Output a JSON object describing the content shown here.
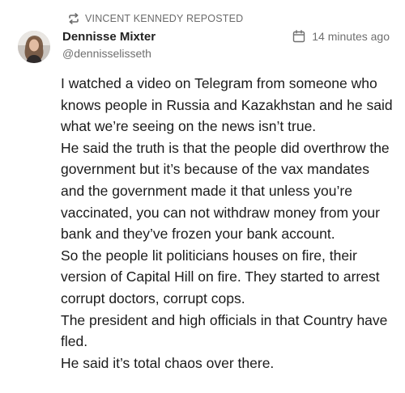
{
  "repost": {
    "label": "VINCENT KENNEDY REPOSTED",
    "icon": "repost-icon"
  },
  "author": {
    "name": "Dennisse Mixter",
    "handle": "@dennisselisseth",
    "avatar_icon": "avatar"
  },
  "timestamp": {
    "text": "14 minutes ago",
    "icon": "calendar-icon"
  },
  "body": {
    "paragraphs": [
      "I watched a video on Telegram from someone who knows people in Russia and Kazakhstan and he said what we’re seeing on the news isn’t true.",
      "He said the truth is that the people did overthrow the government but it’s because of the vax mandates and the government made it that unless you’re vaccinated, you can not withdraw money from your bank and they’ve frozen your bank account.",
      "So the people lit politicians houses on fire, their version of Capital Hill on fire. They started to arrest corrupt doctors, corrupt cops.",
      "The president and high officials in that Country have fled.",
      "He said it’s total chaos over there."
    ]
  },
  "colors": {
    "meta_text": "#6f6f6f",
    "body_text": "#1b1b1b",
    "background": "#ffffff"
  }
}
